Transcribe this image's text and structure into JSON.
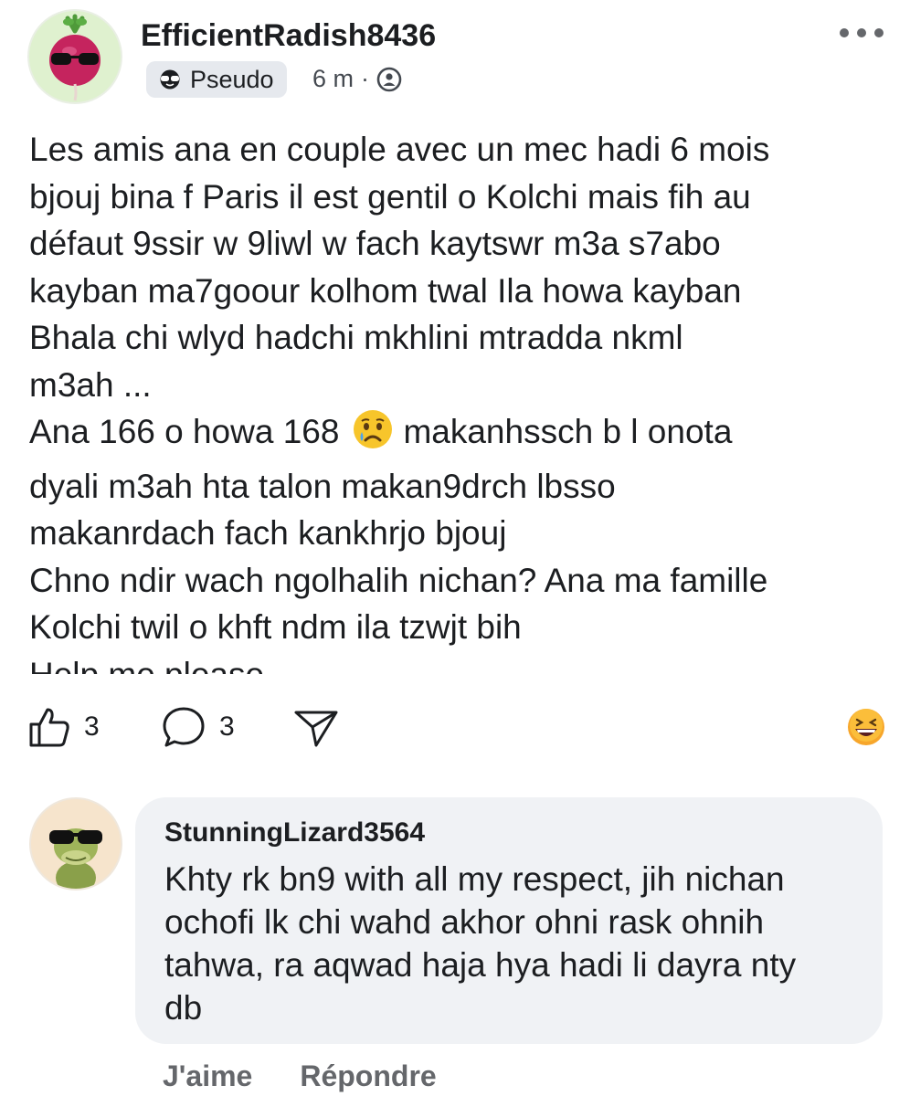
{
  "post": {
    "author": "EfficientRadish8436",
    "badge": "Pseudo",
    "time": "6 m",
    "separator": "·",
    "avatar_icon": "radish-sunglasses-avatar",
    "body_lines": [
      "Les amis ana en couple avec un mec hadi 6  mois",
      "bjouj bina f Paris il est gentil o Kolchi mais fih au",
      "défaut 9ssir w 9liwl w fach kaytswr m3a s7abo",
      "kayban ma7goour kolhom twal Ila howa kayban",
      "Bhala chi wlyd hadchi mkhlini mtradda nkml",
      "m3ah ...",
      "Ana 166 o howa 168",
      "makanhssch b l onota",
      "dyali m3ah hta talon makan9drch lbsso",
      "makanrdach fach kankhrjo bjouj",
      "Chno ndir wach ngolhalih nichan? Ana ma famille",
      "Kolchi twil o khft ndm ila tzwjt bih",
      "Help me please"
    ]
  },
  "actions": {
    "likes": "3",
    "comments": "3"
  },
  "comment": {
    "author": "StunningLizard3564",
    "avatar_icon": "lizard-sunglasses-avatar",
    "lines": [
      "Khty rk bn9 with all my respect, jih nichan",
      "ochofi lk chi wahd akhor ohni rask ohnih",
      "tahwa, ra aqwad haja hya hadi li dayra nty",
      "db"
    ],
    "like_label": "J'aime",
    "reply_label": "Répondre"
  },
  "colors": {
    "bubble": "#f0f2f5",
    "secondary_text": "#65676b",
    "badge_bg": "#e6e9ee"
  }
}
